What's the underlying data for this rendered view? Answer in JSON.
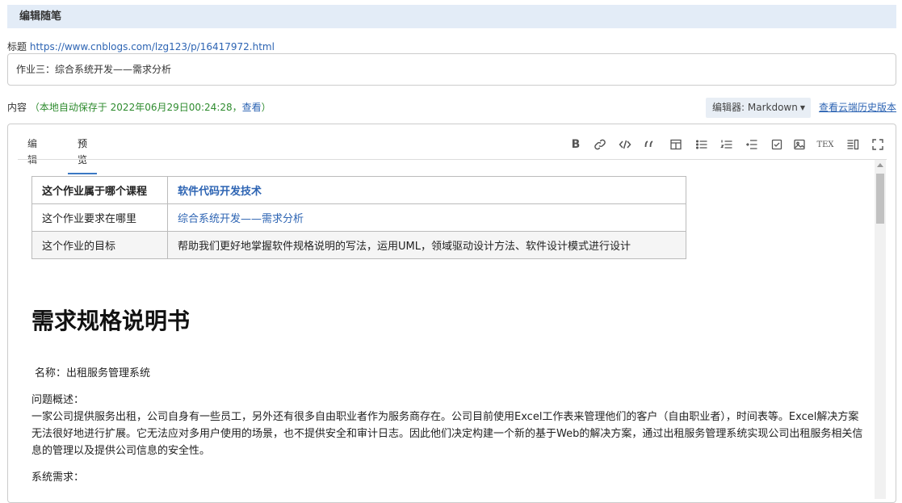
{
  "header": {
    "title": "编辑随笔"
  },
  "title_field": {
    "label": "标题",
    "url": "https://www.cnblogs.com/lzg123/p/16417972.html",
    "value": "作业三：综合系统开发——需求分析"
  },
  "content_line": {
    "label": "内容",
    "autosave_text": "（本地自动保存于 2022年06月29日00:24:28，",
    "view_link": "查看",
    "close_paren": "）"
  },
  "editor_select": {
    "label": "编辑器: Markdown"
  },
  "history_link": "查看云端历史版本",
  "tabs": {
    "edit": "编辑",
    "preview": "预览"
  },
  "toolbar_icons": [
    "bold-icon",
    "link-icon",
    "code-icon",
    "quote-icon",
    "table-icon",
    "unordered-list-icon",
    "ordered-list-icon",
    "indent-icon",
    "checkbox-icon",
    "image-icon",
    "tex-icon",
    "side-preview-icon",
    "fullscreen-icon"
  ],
  "toolbar_text": {
    "bold": "B",
    "tex": "TEX"
  },
  "preview": {
    "table": [
      {
        "key": "这个作业属于哪个课程",
        "value": "软件代码开发技术"
      },
      {
        "key": "这个作业要求在哪里",
        "value": "综合系统开发——需求分析"
      },
      {
        "key": "这个作业的目标",
        "value": "帮助我们更好地掌握软件规格说明的写法，运用UML，领域驱动设计方法、软件设计模式进行设计"
      }
    ],
    "heading": "需求规格说明书",
    "name_line": "名称：出租服务管理系统",
    "problem_heading": "问题概述：",
    "problem_text": "一家公司提供服务出租，公司自身有一些员工，另外还有很多自由职业者作为服务商存在。公司目前使用Excel工作表来管理他们的客户（自由职业者），时间表等。Excel解决方案无法很好地进行扩展。它无法应对多用户使用的场景，也不提供安全和审计日志。因此他们决定构建一个新的基于Web的解决方案，通过出租服务管理系统实现公司出租服务相关信息的管理以及提供公司信息的安全性。",
    "requirements_heading": "系统需求："
  }
}
